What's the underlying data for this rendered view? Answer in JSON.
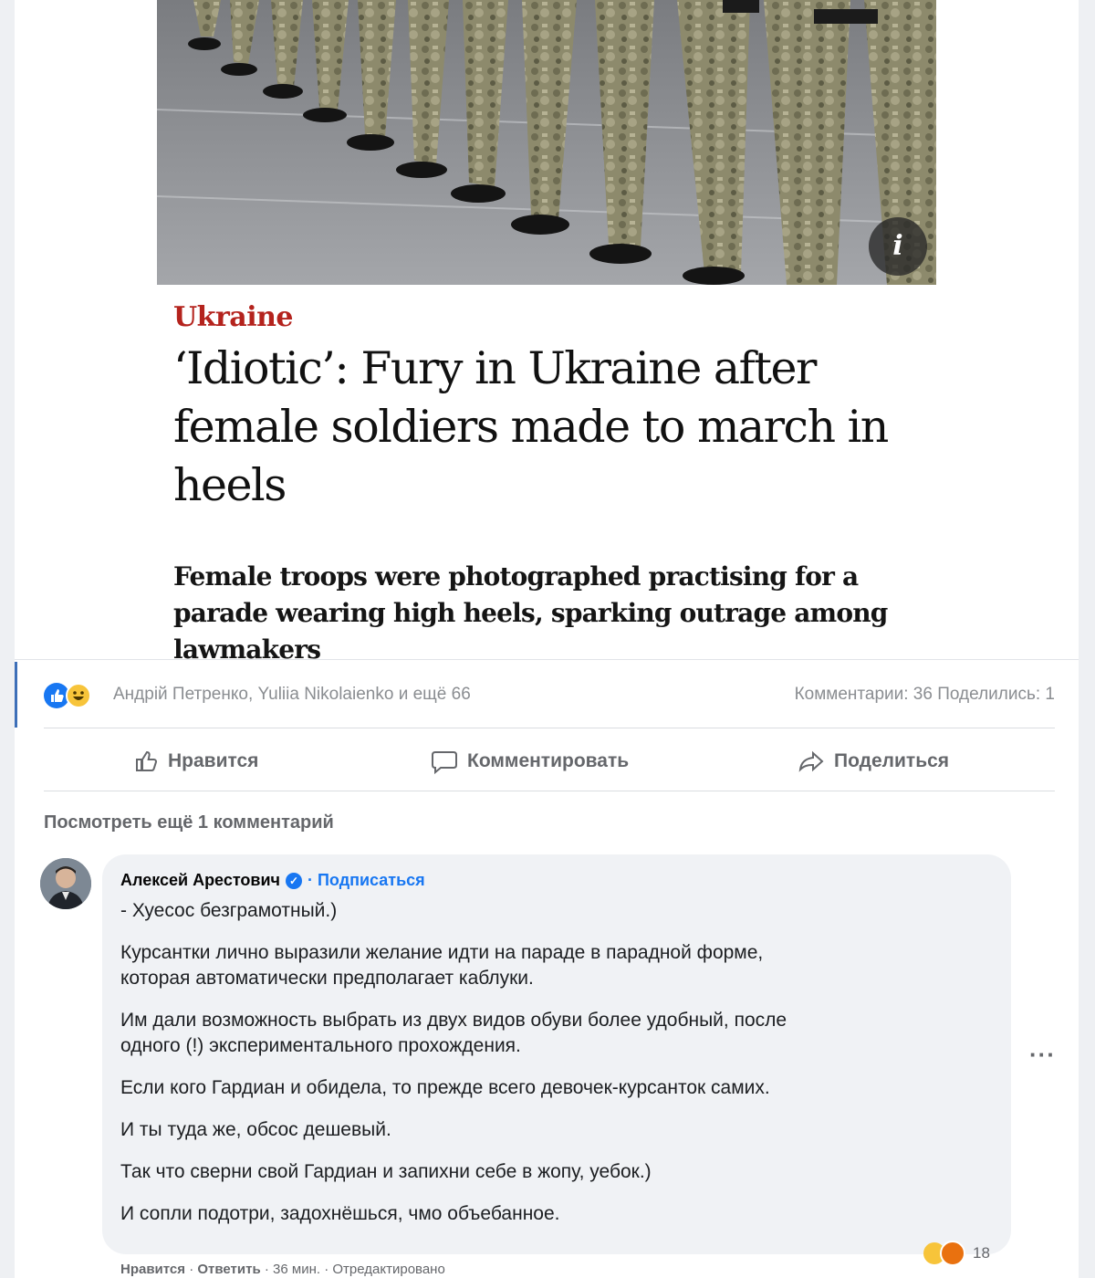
{
  "article": {
    "photo_alt": "",
    "info_icon_label": "i",
    "kicker": "Ukraine",
    "headline": "‘Idiotic’: Fury in Ukraine after female soldiers made to march in heels",
    "standfirst": "Female troops were photographed practising for a parade wearing high heels, sparking outrage among lawmakers",
    "kicker_color": "#b4231d"
  },
  "reactions": {
    "icons": [
      "like-icon",
      "haha-icon"
    ],
    "reactors": "Андрій Петренко, Yuliia Nikolaienko и ещё 66",
    "comments_count": "Комментарии: 36",
    "shares_count": "Поделились: 1"
  },
  "actions": {
    "like": "Нравится",
    "comment": "Комментировать",
    "share": "Поделиться"
  },
  "comments": {
    "view_more": "Посмотреть ещё 1 комментарий",
    "items": [
      {
        "author": "Алексей Арестович",
        "verified": true,
        "subscribe": "· Подписаться",
        "lines": [
          "- Хуесос безграмотный.)",
          "Курсантки лично выразили желание идти на параде в парадной форме,",
          "которая автоматически предполагает каблуки.",
          "Им дали возможность выбрать из двух видов обуви более удобный, после",
          "одного (!) экспериментального прохождения.",
          "Если кого Гардиан и обидела, то прежде всего девочек-курсанток самих.",
          "И ты туда же, обсос дешевый.",
          "Так что сверни свой Гардиан и запихни себе в жопу, уебок.)",
          "И сопли подотри, задохнёшься, чмо объебанное."
        ],
        "reaction_count": "18",
        "meta": {
          "like": "Нравится",
          "reply": "Ответить",
          "time": "36 мин.",
          "edited": "Отредактировано"
        }
      }
    ],
    "more_options": "···"
  },
  "colors": {
    "accent": "#1877f2",
    "bubble": "#f0f2f5"
  }
}
